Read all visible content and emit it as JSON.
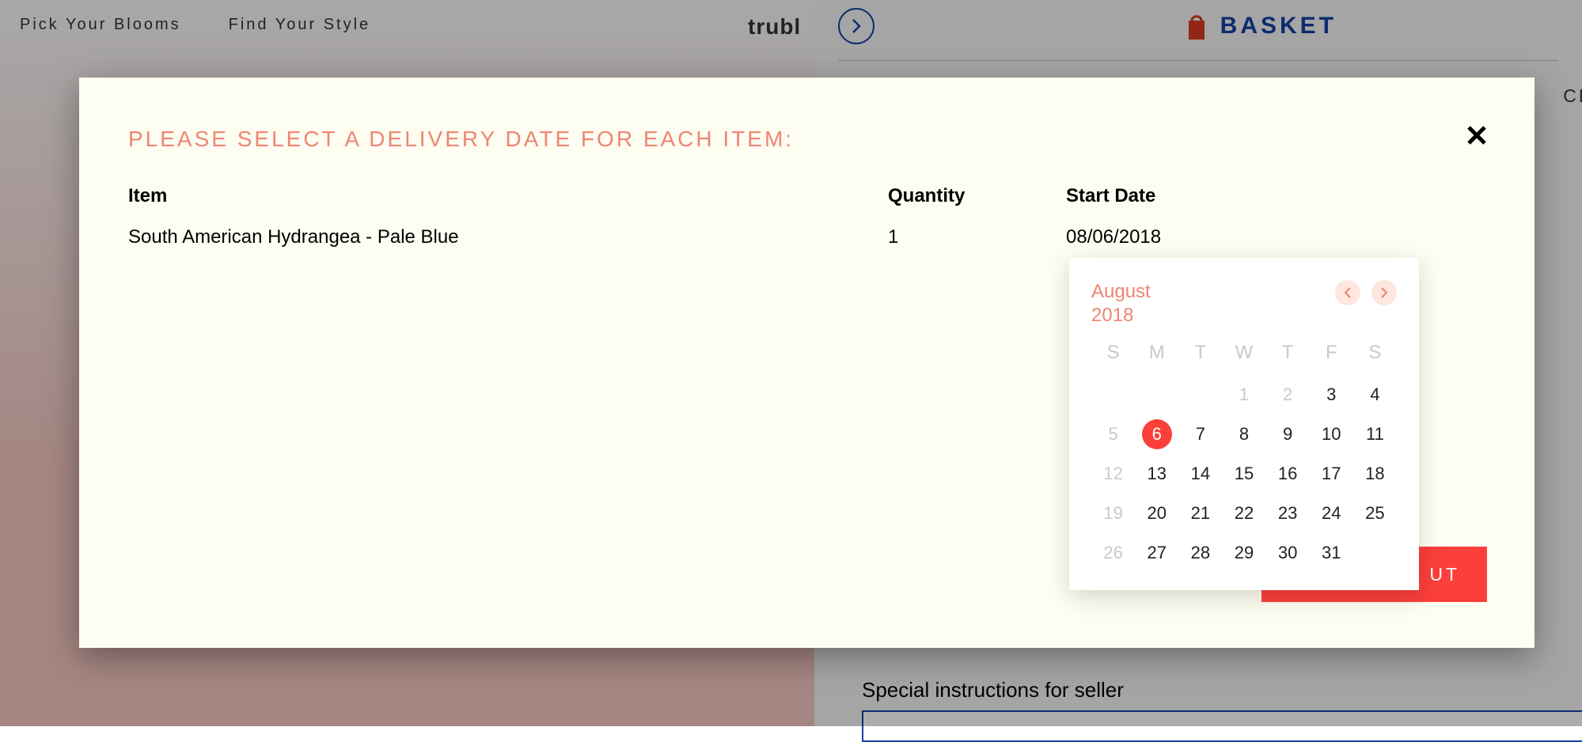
{
  "nav": {
    "item1": "Pick Your Blooms",
    "item2": "Find Your Style",
    "logo": "trubl"
  },
  "basket": {
    "label": "BASKET",
    "clear": "CLE",
    "special_label": "Special instructions for seller"
  },
  "modal": {
    "title": "PLEASE SELECT A DELIVERY DATE FOR EACH ITEM:",
    "col_item": "Item",
    "col_qty": "Quantity",
    "col_date": "Start Date",
    "row": {
      "name": "South American Hydrangea - Pale Blue",
      "qty": "1",
      "date": "08/06/2018"
    },
    "checkout_suffix": "UT"
  },
  "calendar": {
    "month": "August",
    "year": "2018",
    "dow": [
      "S",
      "M",
      "T",
      "W",
      "T",
      "F",
      "S"
    ],
    "days": [
      {
        "n": "",
        "state": "blank"
      },
      {
        "n": "",
        "state": "blank"
      },
      {
        "n": "",
        "state": "blank"
      },
      {
        "n": "1",
        "state": "disabled"
      },
      {
        "n": "2",
        "state": "disabled"
      },
      {
        "n": "3",
        "state": "normal"
      },
      {
        "n": "4",
        "state": "normal"
      },
      {
        "n": "5",
        "state": "disabled"
      },
      {
        "n": "6",
        "state": "selected"
      },
      {
        "n": "7",
        "state": "normal"
      },
      {
        "n": "8",
        "state": "normal"
      },
      {
        "n": "9",
        "state": "normal"
      },
      {
        "n": "10",
        "state": "normal"
      },
      {
        "n": "11",
        "state": "normal"
      },
      {
        "n": "12",
        "state": "disabled"
      },
      {
        "n": "13",
        "state": "normal"
      },
      {
        "n": "14",
        "state": "normal"
      },
      {
        "n": "15",
        "state": "normal"
      },
      {
        "n": "16",
        "state": "normal"
      },
      {
        "n": "17",
        "state": "normal"
      },
      {
        "n": "18",
        "state": "normal"
      },
      {
        "n": "19",
        "state": "disabled"
      },
      {
        "n": "20",
        "state": "normal"
      },
      {
        "n": "21",
        "state": "normal"
      },
      {
        "n": "22",
        "state": "normal"
      },
      {
        "n": "23",
        "state": "normal"
      },
      {
        "n": "24",
        "state": "normal"
      },
      {
        "n": "25",
        "state": "normal"
      },
      {
        "n": "26",
        "state": "disabled"
      },
      {
        "n": "27",
        "state": "normal"
      },
      {
        "n": "28",
        "state": "normal"
      },
      {
        "n": "29",
        "state": "normal"
      },
      {
        "n": "30",
        "state": "normal"
      },
      {
        "n": "31",
        "state": "normal"
      }
    ]
  }
}
